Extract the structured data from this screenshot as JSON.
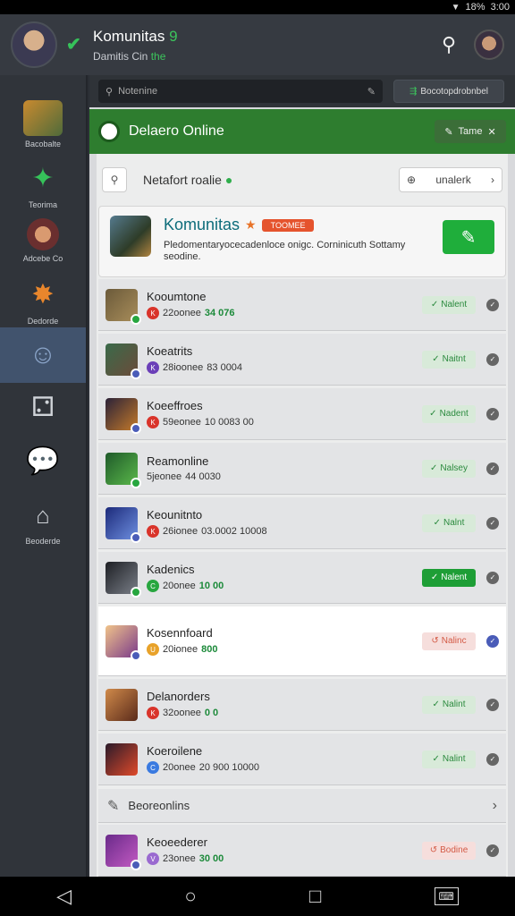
{
  "status_bar": {
    "battery": "18%",
    "time": "3:00"
  },
  "header": {
    "title_main": "Komunitas",
    "title_accent": "9",
    "subtitle_main": "Damitis Cin",
    "subtitle_accent": "the"
  },
  "sidebar": {
    "items": [
      {
        "label": "Bacobalte"
      },
      {
        "label": "Teorima"
      },
      {
        "label": "Adcebe Co"
      },
      {
        "label": "Dedorde"
      },
      {
        "label": ""
      },
      {
        "label": ""
      },
      {
        "label": ""
      },
      {
        "label": "Beoderde"
      }
    ]
  },
  "searchbar": {
    "placeholder": "Notenine",
    "filter_label": "Bocotopdrobnbel"
  },
  "banner": {
    "title": "Delaero Online",
    "theme_label": "Tame"
  },
  "crumb": {
    "text": "Netafort",
    "text2": "roalie",
    "unlock_label": "unalerk"
  },
  "community": {
    "title": "Komunitas",
    "badge": "TOOMEE",
    "description": "Pledomentaryocecadenloce onigc. Corninicuth Sottamy seodine."
  },
  "rows": [
    {
      "title": "Kooumtone",
      "sub": "22oonee",
      "num": "34 076",
      "btn": "Nalent",
      "style": "normal"
    },
    {
      "title": "Koeatrits",
      "sub": "28ioonee",
      "num": "83 0004",
      "btn": "Naitnt",
      "style": "normal"
    },
    {
      "title": "Koeeffroes",
      "sub": "59eonee",
      "num": "10 0083 00",
      "btn": "Nadent",
      "style": "normal"
    },
    {
      "title": "Reamonline",
      "sub": "5jeonee",
      "num": "44 0030",
      "btn": "Nalsey",
      "style": "normal"
    },
    {
      "title": "Keounitnto",
      "sub": "26ionee",
      "num": "03.0002 10008",
      "btn": "Nalnt",
      "style": "normal"
    },
    {
      "title": "Kadenics",
      "sub": "20onee",
      "num": "10 00",
      "btn": "Nalent",
      "style": "solid"
    },
    {
      "title": "Kosennfoard",
      "sub": "20ionee",
      "num": "800",
      "btn": "Nalinc",
      "style": "warn"
    },
    {
      "title": "Delanorders",
      "sub": "32oonee",
      "num": "0 0",
      "btn": "Nalint",
      "style": "normal"
    },
    {
      "title": "Koeroilene",
      "sub": "20onee",
      "num": "20 900 10000",
      "btn": "Nalint",
      "style": "normal"
    },
    {
      "title": "Keoeederer",
      "sub": "23onee",
      "num": "30 00",
      "btn": "Bodine",
      "style": "warn"
    }
  ],
  "link_row": {
    "label": "Beoreonlins"
  },
  "colors": {
    "accent": "#1fae3b",
    "banner": "#2e7d2f",
    "sidebar_active": "#41536d"
  }
}
